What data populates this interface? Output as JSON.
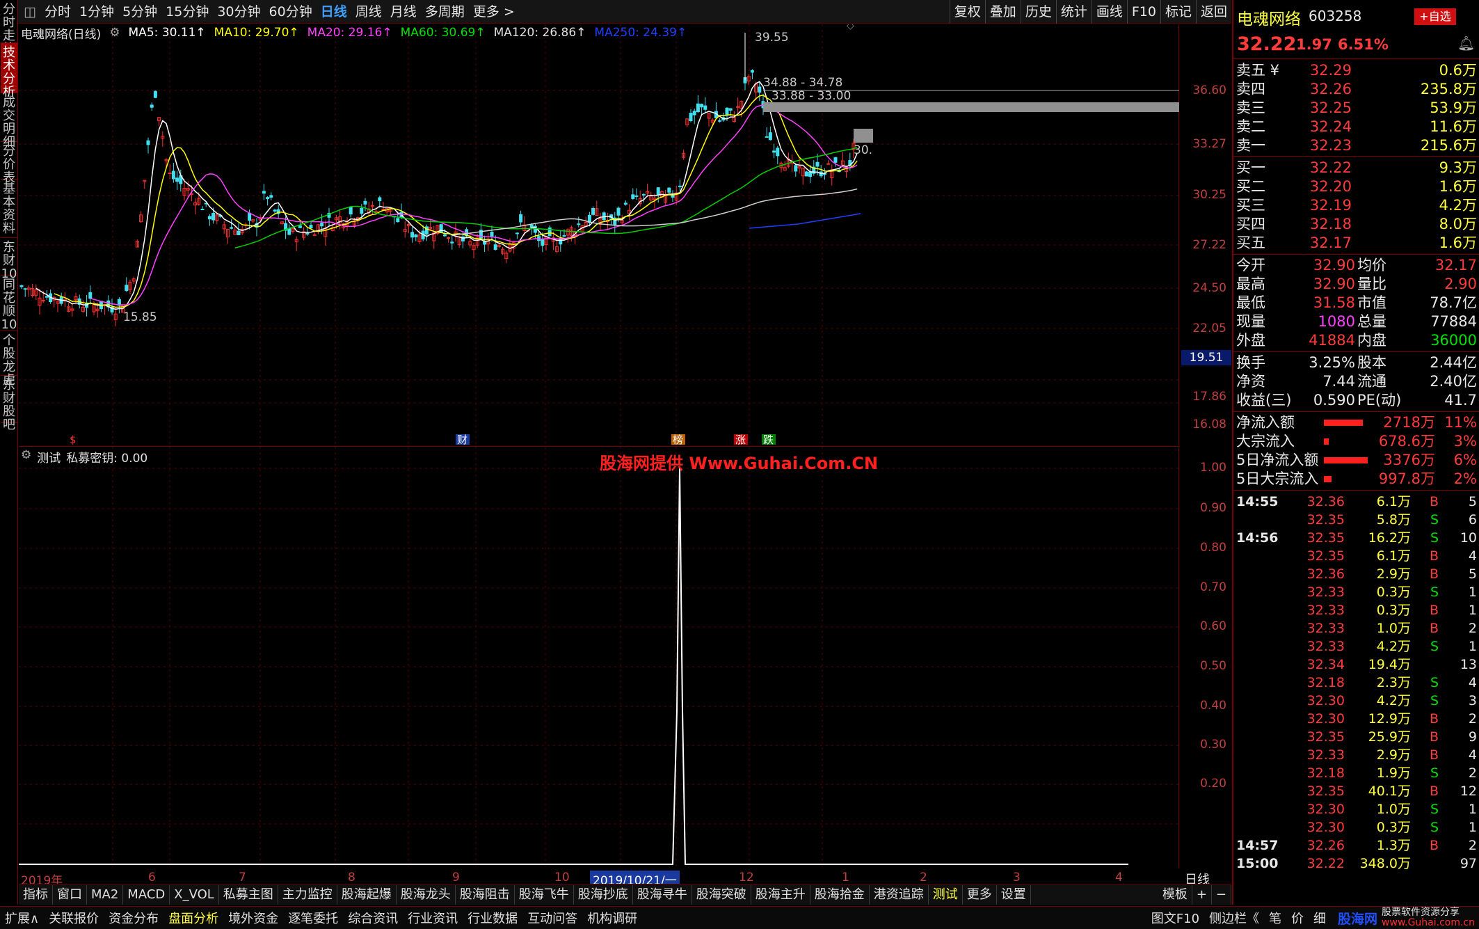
{
  "toolbar": {
    "periods": [
      "分时",
      "1分钟",
      "5分钟",
      "15分钟",
      "30分钟",
      "60分钟",
      "日线",
      "周线",
      "月线",
      "多周期",
      "更多 >"
    ],
    "right_buttons": [
      "复权",
      "叠加",
      "历史",
      "统计",
      "画线",
      "F10",
      "标记",
      "返回"
    ]
  },
  "left_nav": [
    "分时走势",
    "技术分析",
    "成交明细",
    "分价表",
    "基本资料",
    "东财10",
    "同花顺10",
    "个股龙虎",
    "东财股吧"
  ],
  "kline": {
    "title": "电魂网络(日线)",
    "ma": [
      {
        "label": "MA5: 30.11↑",
        "color": "#ffffff"
      },
      {
        "label": "MA10: 29.70↑",
        "color": "#ffff00"
      },
      {
        "label": "MA20: 29.16↑",
        "color": "#ff40ff"
      },
      {
        "label": "MA60: 30.69↑",
        "color": "#00e000"
      },
      {
        "label": "MA120: 26.86↑",
        "color": "#e0e0e0"
      },
      {
        "label": "MA250: 24.39↑",
        "color": "#2040ff"
      }
    ],
    "yticks": [
      "36.60",
      "33.27",
      "30.25",
      "27.22",
      "24.50",
      "22.05",
      "19.51",
      "17.86",
      "16.08"
    ],
    "current_price_tag": "19.51",
    "high_label": "39.55",
    "low_label": "15.85",
    "range1": "34.88 - 34.78",
    "range2": "33.88 - 33.00",
    "cut_label": "30.",
    "markers": [
      "$",
      "财",
      "榜",
      "涨",
      "跌"
    ]
  },
  "indicator": {
    "name": "测试",
    "legend": "私募密钥: 0.00",
    "watermark": "股海网提供 Www.Guhai.Com.CN",
    "yticks": [
      "1.00",
      "0.90",
      "0.80",
      "0.70",
      "0.60",
      "0.50",
      "0.40",
      "0.30",
      "0.20"
    ]
  },
  "xaxis": {
    "labels": [
      "2019年",
      "6",
      "7",
      "8",
      "9",
      "10",
      "2019/10/21/一",
      "12",
      "1",
      "2",
      "3",
      "4"
    ],
    "period": "日线"
  },
  "bottom_tabs": [
    "指标",
    "窗口",
    "MA2",
    "MACD",
    "X_VOL",
    "私募主图",
    "主力监控",
    "股海起爆",
    "股海龙头",
    "股海阻击",
    "股海飞牛",
    "股海抄底",
    "股海寻牛",
    "股海突破",
    "股海主升",
    "股海拾金",
    "港资追踪",
    "测试",
    "更多",
    "设置"
  ],
  "bottom_tabs_right": [
    "模板",
    "+",
    "−"
  ],
  "status_bar": [
    "扩展∧",
    "关联报价",
    "资金分布",
    "盘面分析",
    "境外资金",
    "逐笔委托",
    "综合资讯",
    "行业资讯",
    "行业数据",
    "互动问答",
    "机构调研"
  ],
  "status_right": [
    "图文F10",
    "侧边栏《",
    "笔",
    "价",
    "细"
  ],
  "status_logo": "股海网",
  "status_slogan": "股票软件资源分享",
  "status_url": "www.Guhai.com.cn",
  "quote": {
    "name": "电魂网络",
    "code": "603258",
    "add_button": "+自选",
    "price": "32.22",
    "change": "1.97",
    "pct": "6.51%",
    "asks": [
      {
        "label": "卖五 ¥",
        "price": "32.29",
        "vol": "0.6万"
      },
      {
        "label": "卖四",
        "price": "32.26",
        "vol": "235.8万"
      },
      {
        "label": "卖三",
        "price": "32.25",
        "vol": "53.9万"
      },
      {
        "label": "卖二",
        "price": "32.24",
        "vol": "11.6万"
      },
      {
        "label": "卖一",
        "price": "32.23",
        "vol": "215.6万"
      }
    ],
    "bids": [
      {
        "label": "买一",
        "price": "32.22",
        "vol": "9.3万"
      },
      {
        "label": "买二",
        "price": "32.20",
        "vol": "1.6万"
      },
      {
        "label": "买三",
        "price": "32.19",
        "vol": "4.2万"
      },
      {
        "label": "买四",
        "price": "32.18",
        "vol": "8.0万"
      },
      {
        "label": "买五",
        "price": "32.17",
        "vol": "1.6万"
      }
    ],
    "stats": [
      {
        "l1": "今开",
        "v1": "32.90",
        "l2": "均价",
        "v2": "32.17",
        "c1": "red",
        "c2": "red"
      },
      {
        "l1": "最高",
        "v1": "32.90",
        "l2": "量比",
        "v2": "2.90",
        "c1": "red",
        "c2": "red"
      },
      {
        "l1": "最低",
        "v1": "31.58",
        "l2": "市值",
        "v2": "78.7亿",
        "c1": "red",
        "c2": "wht"
      },
      {
        "l1": "现量",
        "v1": "1080",
        "l2": "总量",
        "v2": "77884",
        "c1": "mag",
        "c2": "wht"
      },
      {
        "l1": "外盘",
        "v1": "41884",
        "l2": "内盘",
        "v2": "36000",
        "c1": "red",
        "c2": "grn"
      }
    ],
    "fund": [
      {
        "l1": "换手",
        "v1": "3.25%",
        "l2": "股本",
        "v2": "2.44亿"
      },
      {
        "l1": "净资",
        "v1": "7.44",
        "l2": "流通",
        "v2": "2.40亿"
      },
      {
        "l1": "收益(三)",
        "v1": "0.590",
        "l2": "PE(动)",
        "v2": "41.7"
      }
    ],
    "flows": [
      {
        "label": "净流入额",
        "value": "2718万",
        "pct": "11%",
        "bar": 0.8
      },
      {
        "label": "大宗流入",
        "value": "678.6万",
        "pct": "3%",
        "bar": 0.1
      },
      {
        "label": "5日净流入额",
        "value": "3376万",
        "pct": "6%",
        "bar": 0.9
      },
      {
        "label": "5日大宗流入",
        "value": "997.8万",
        "pct": "2%",
        "bar": 0.15
      }
    ],
    "ticks": [
      {
        "t": "14:55",
        "p": "32.36",
        "v": "6.1万",
        "d": "B",
        "n": "5"
      },
      {
        "t": "",
        "p": "32.35",
        "v": "5.8万",
        "d": "S",
        "n": "6"
      },
      {
        "t": "14:56",
        "p": "32.35",
        "v": "16.2万",
        "d": "S",
        "n": "10"
      },
      {
        "t": "",
        "p": "32.35",
        "v": "6.1万",
        "d": "B",
        "n": "4"
      },
      {
        "t": "",
        "p": "32.36",
        "v": "2.9万",
        "d": "B",
        "n": "5"
      },
      {
        "t": "",
        "p": "32.33",
        "v": "0.3万",
        "d": "S",
        "n": "1"
      },
      {
        "t": "",
        "p": "32.33",
        "v": "0.3万",
        "d": "B",
        "n": "1"
      },
      {
        "t": "",
        "p": "32.33",
        "v": "1.0万",
        "d": "B",
        "n": "2"
      },
      {
        "t": "",
        "p": "32.33",
        "v": "4.2万",
        "d": "S",
        "n": "1"
      },
      {
        "t": "",
        "p": "32.34",
        "v": "19.4万",
        "d": "",
        "n": "13"
      },
      {
        "t": "",
        "p": "32.18",
        "v": "2.3万",
        "d": "S",
        "n": "4"
      },
      {
        "t": "",
        "p": "32.30",
        "v": "4.2万",
        "d": "S",
        "n": "3"
      },
      {
        "t": "",
        "p": "32.30",
        "v": "12.9万",
        "d": "B",
        "n": "2"
      },
      {
        "t": "",
        "p": "32.35",
        "v": "25.9万",
        "d": "B",
        "n": "9"
      },
      {
        "t": "",
        "p": "32.33",
        "v": "2.9万",
        "d": "B",
        "n": "4"
      },
      {
        "t": "",
        "p": "32.18",
        "v": "1.9万",
        "d": "S",
        "n": "2"
      },
      {
        "t": "",
        "p": "32.35",
        "v": "40.1万",
        "d": "B",
        "n": "12"
      },
      {
        "t": "",
        "p": "32.30",
        "v": "1.0万",
        "d": "S",
        "n": "1"
      },
      {
        "t": "",
        "p": "32.30",
        "v": "0.3万",
        "d": "S",
        "n": "1"
      },
      {
        "t": "14:57",
        "p": "32.26",
        "v": "1.3万",
        "d": "B",
        "n": "2"
      },
      {
        "t": "15:00",
        "p": "32.22",
        "v": "348.0万",
        "d": "",
        "n": "97"
      }
    ]
  }
}
